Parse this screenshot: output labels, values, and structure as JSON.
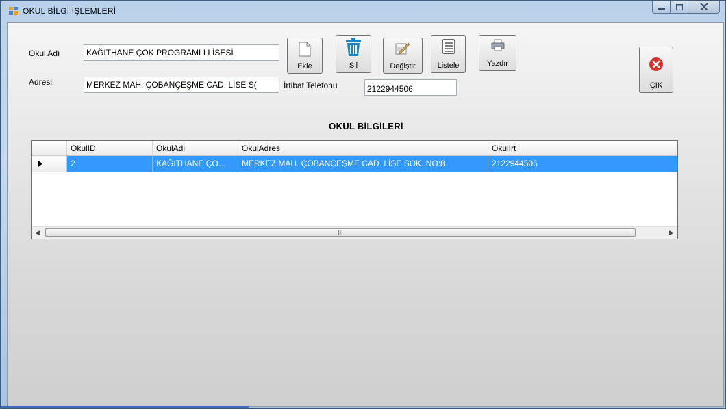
{
  "window": {
    "title": "OKUL BİLGİ İŞLEMLERİ",
    "controls": [
      "minimize-icon",
      "maximize-icon",
      "close-icon"
    ]
  },
  "form": {
    "school_name_label": "Okul Adı",
    "school_name_value": "KAĞITHANE ÇOK PROGRAMLI LİSESİ",
    "address_label": "Adresi",
    "address_value": "MERKEZ MAH. ÇOBANÇEŞME CAD. LİSE S(",
    "phone_label": "İrtibat Telefonu",
    "phone_value": "2122944506"
  },
  "toolbar": {
    "add_label": "Ekle",
    "delete_label": "Sil",
    "edit_label": "Değiştir",
    "list_label": "Listele",
    "print_label": "Yazdır",
    "exit_label": "ÇIK"
  },
  "section_title": "OKUL BİLGİLERİ",
  "grid": {
    "columns": [
      "OkulID",
      "OkulAdi",
      "OkulAdres",
      "OkulIrt"
    ],
    "rows": [
      [
        "2",
        "KAĞITHANE ÇO...",
        "MERKEZ MAH. ÇOBANÇEŞME CAD. LİSE SOK. NO:8",
        "2122944506"
      ]
    ],
    "scroll_thumb_glyph": "III"
  },
  "colors": {
    "selection": "#3399ff",
    "exit_icon": "#d9342b"
  }
}
